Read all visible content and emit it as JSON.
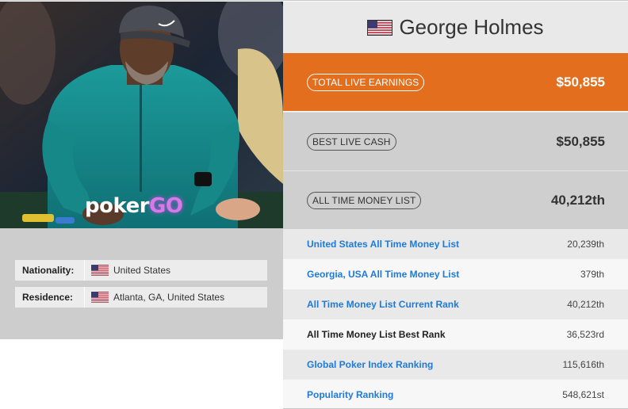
{
  "player": {
    "name": "George Holmes",
    "flag_icon": "us-flag-icon"
  },
  "photo": {
    "watermark": "pokerGO"
  },
  "info": {
    "nationality_label": "Nationality:",
    "nationality_value": "United States",
    "residence_label": "Residence:",
    "residence_value": "Atlanta, GA, United States"
  },
  "stats": {
    "total_live_earnings_label": "TOTAL LIVE EARNINGS",
    "total_live_earnings_value": "$50,855",
    "best_live_cash_label": "BEST LIVE CASH",
    "best_live_cash_value": "$50,855",
    "all_time_money_list_label": "ALL TIME MONEY LIST",
    "all_time_money_list_value": "40,212th"
  },
  "rankings": [
    {
      "label": "United States All Time Money List",
      "value": "20,239th",
      "link": true
    },
    {
      "label": "Georgia, USA All Time Money List",
      "value": "379th",
      "link": true
    },
    {
      "label": "All Time Money List Current Rank",
      "value": "40,212th",
      "link": true
    },
    {
      "label": "All Time Money List Best Rank",
      "value": "36,523rd",
      "link": false
    },
    {
      "label": "Global Poker Index Ranking",
      "value": "115,616th",
      "link": true
    },
    {
      "label": "Popularity Ranking",
      "value": "548,621st",
      "link": true
    }
  ],
  "colors": {
    "accent_orange": "#e36f1e",
    "link_blue": "#1f7ad6",
    "panel_grey": "#cfcfcf"
  }
}
